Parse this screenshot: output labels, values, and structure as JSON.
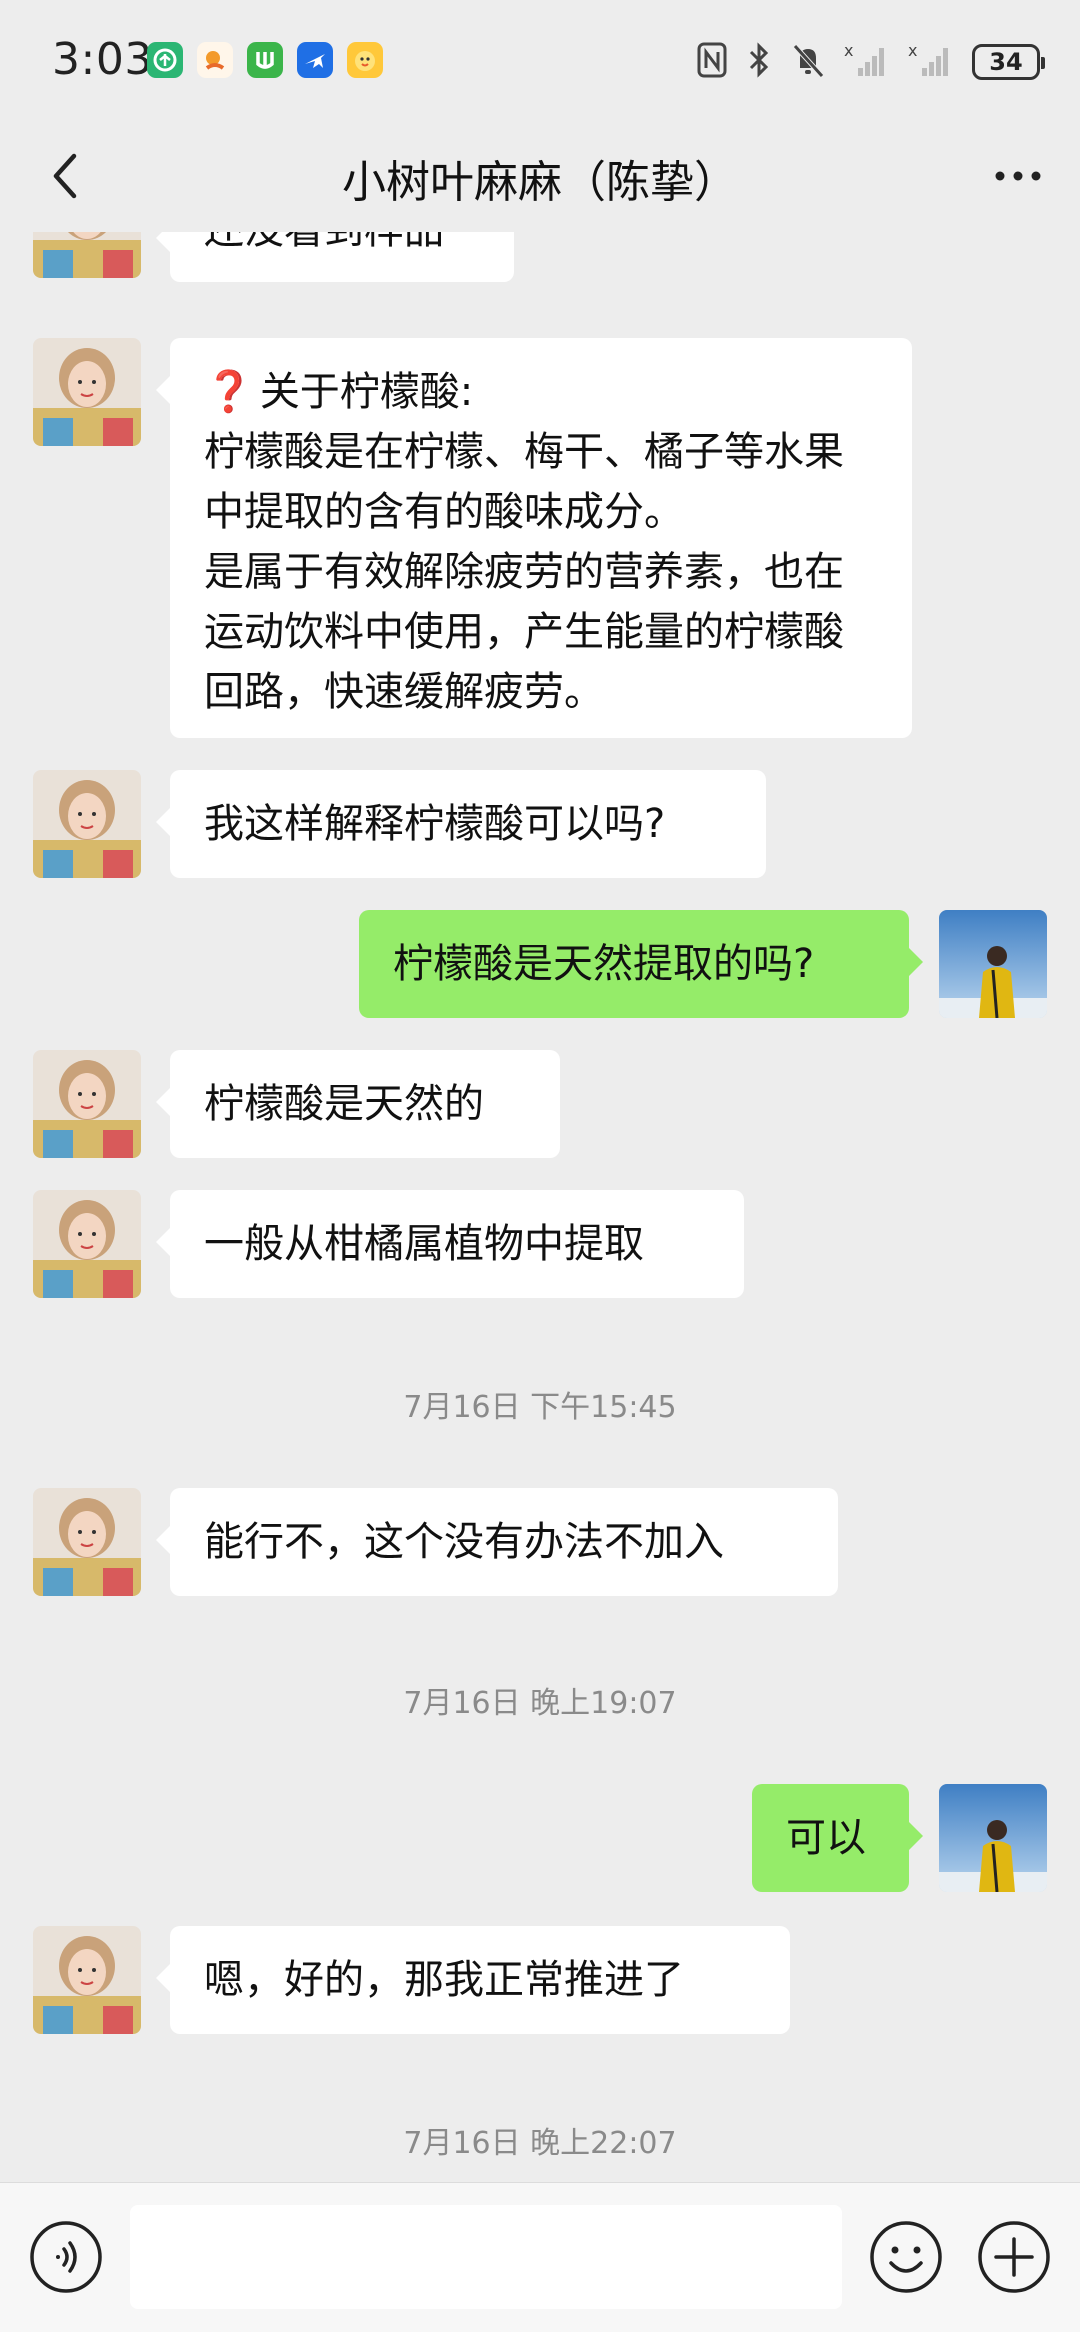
{
  "status_bar": {
    "time": "3:03",
    "battery": "34",
    "app_icons": [
      {
        "name": "green-leaf-app-icon",
        "color": "#2bb673"
      },
      {
        "name": "orange-bird-app-icon",
        "color": "#ffffff"
      },
      {
        "name": "green-shield-app-icon",
        "color": "#3bb54a"
      },
      {
        "name": "blue-plane-app-icon",
        "color": "#1f6fe5"
      },
      {
        "name": "yellow-duck-app-icon",
        "color": "#ffb428"
      }
    ]
  },
  "header": {
    "title": "小树叶麻麻（陈挚）"
  },
  "colors": {
    "bubble_in": "#ffffff",
    "bubble_out": "#95ec69",
    "background": "#ededed"
  },
  "chat": {
    "msg_partial": "还没看到样品",
    "msg_citric_title": "关于柠檬酸:",
    "msg_citric_line1": "柠檬酸是在柠檬、梅干、橘子等水果中提取的含有的酸味成分。",
    "msg_citric_line2": "是属于有效解除疲劳的营养素，也在运动饮料中使用，产生能量的柠檬酸回路，快速缓解疲劳。",
    "msg_explain": "我这样解释柠檬酸可以吗?",
    "msg_natural_q": "柠檬酸是天然提取的吗?",
    "msg_natural_a": "柠檬酸是天然的",
    "msg_citrus": "一般从柑橘属植物中提取",
    "time1": "7月16日 下午15:45",
    "msg_cannot": "能行不，这个没有办法不加入",
    "time2": "7月16日 晚上19:07",
    "msg_ok": "可以",
    "msg_proceed": "嗯，好的，那我正常推进了",
    "time3": "7月16日 晚上22:07"
  },
  "input": {
    "value": ""
  }
}
